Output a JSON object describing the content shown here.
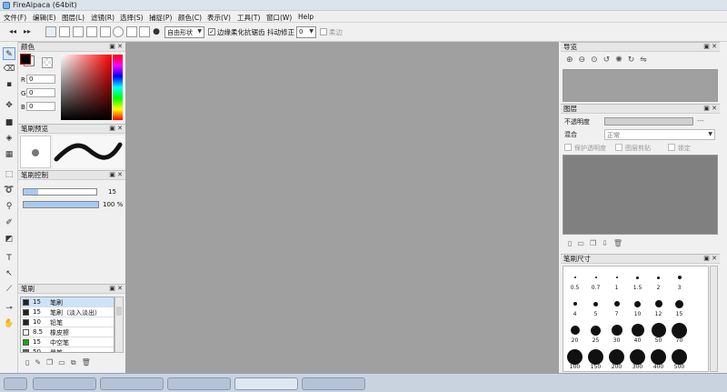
{
  "title": "FireAlpaca (64bit)",
  "menu": [
    "文件(F)",
    "编辑(E)",
    "图层(L)",
    "滤镜(R)",
    "选择(S)",
    "捕捉(P)",
    "颜色(C)",
    "表示(V)",
    "工具(T)",
    "窗口(W)",
    "Help"
  ],
  "toolbar": {
    "snap_mode": "自由形状",
    "antialias_checkbox_checked": true,
    "antialias_label": "边缘柔化抗锯齿",
    "stabilizer_label": "抖动修正",
    "stabilizer_value": "0",
    "stabilizer_arrow": "▼",
    "snap_mode_arrow": "▼",
    "auto_checked": false,
    "auto_label": "柔边"
  },
  "color_panel": {
    "title": "颜色",
    "r_label": "R",
    "g_label": "G",
    "b_label": "B",
    "r": "0",
    "g": "0",
    "b": "0",
    "primary_color": "#000000",
    "secondary_color": "#ffffff"
  },
  "brush_preview": {
    "title": "笔刷预览"
  },
  "brush_control": {
    "title": "笔刷控制",
    "size": "15",
    "size_fraction": 0.2,
    "opacity": "100 %",
    "opacity_fraction": 1.0
  },
  "brush_panel": {
    "title": "笔刷",
    "items": [
      {
        "size": "15",
        "name": "笔刷",
        "color": "#222222",
        "selected": true
      },
      {
        "size": "15",
        "name": "笔刷（淡入淡出）",
        "color": "#222222",
        "selected": false
      },
      {
        "size": "10",
        "name": "铅笔",
        "color": "#222222",
        "selected": false
      },
      {
        "size": "8.5",
        "name": "橡皮擦",
        "color": "#ffffff",
        "selected": false
      },
      {
        "size": "15",
        "name": "中空笔",
        "color": "#11aa11",
        "selected": false
      },
      {
        "size": "50",
        "name": "晕笔",
        "color": "#666666",
        "selected": false
      }
    ]
  },
  "navigator": {
    "title": "导览"
  },
  "layers": {
    "title": "图层",
    "opacity_label": "不透明度",
    "opacity_value": "---",
    "blend_label": "混合",
    "blend_value": "正常",
    "protect_alpha": "保护透明度",
    "clipping": "图层剪贴",
    "lock": "锁定"
  },
  "brush_size_panel": {
    "title": "笔刷尺寸",
    "sizes": [
      "0.5",
      "0.7",
      "1",
      "1.5",
      "2",
      "3",
      "4",
      "5",
      "7",
      "10",
      "12",
      "15",
      "20",
      "25",
      "30",
      "40",
      "50",
      "70",
      "100",
      "150",
      "200",
      "300",
      "400",
      "500"
    ]
  },
  "pbtns": "▣ ✕"
}
